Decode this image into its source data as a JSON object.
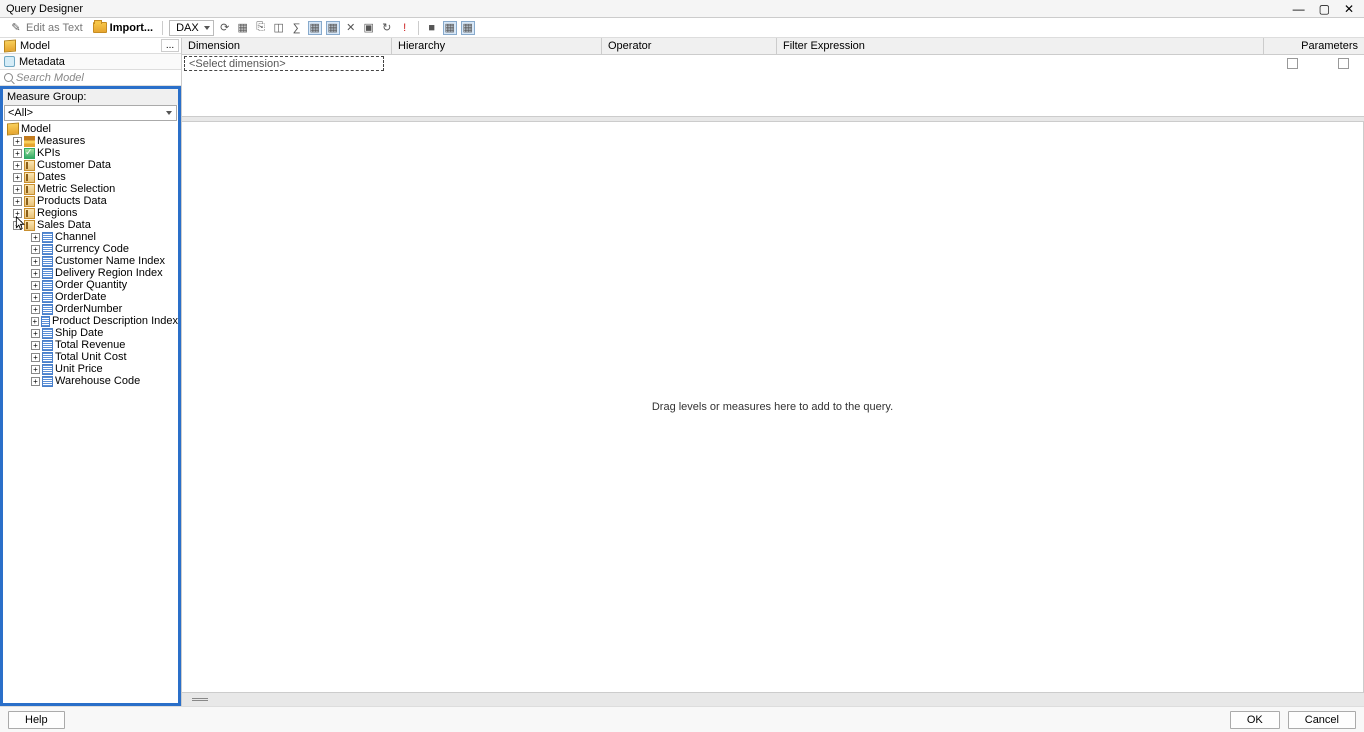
{
  "window": {
    "title": "Query Designer"
  },
  "toolbar": {
    "edit_as_text": "Edit as Text",
    "import": "Import...",
    "lang": "DAX"
  },
  "sidebar": {
    "model_label": "Model",
    "metadata_label": "Metadata",
    "search_placeholder": "Search Model",
    "measure_group_label": "Measure Group:",
    "measure_group_value": "<All>",
    "tree_root": "Model",
    "nodes": [
      {
        "label": "Measures",
        "icon": "meas"
      },
      {
        "label": "KPIs",
        "icon": "kpi"
      },
      {
        "label": "Customer Data",
        "icon": "dim"
      },
      {
        "label": "Dates",
        "icon": "dim"
      },
      {
        "label": "Metric Selection",
        "icon": "dim"
      },
      {
        "label": "Products Data",
        "icon": "dim"
      },
      {
        "label": "Regions",
        "icon": "dim"
      },
      {
        "label": "Sales Data",
        "icon": "dim",
        "expanded": true
      }
    ],
    "sales_children": [
      "Channel",
      "Currency Code",
      "Customer Name Index",
      "Delivery Region Index",
      "Order Quantity",
      "OrderDate",
      "OrderNumber",
      "Product Description Index",
      "Ship Date",
      "Total Revenue",
      "Total Unit Cost",
      "Unit Price",
      "Warehouse Code"
    ]
  },
  "grid": {
    "cols": {
      "dimension": "Dimension",
      "hierarchy": "Hierarchy",
      "operator": "Operator",
      "filter_expr": "Filter Expression",
      "parameters": "Parameters"
    },
    "select_dim": "<Select dimension>"
  },
  "drop_hint": "Drag levels or measures here to add to the query.",
  "footer": {
    "help": "Help",
    "ok": "OK",
    "cancel": "Cancel"
  }
}
